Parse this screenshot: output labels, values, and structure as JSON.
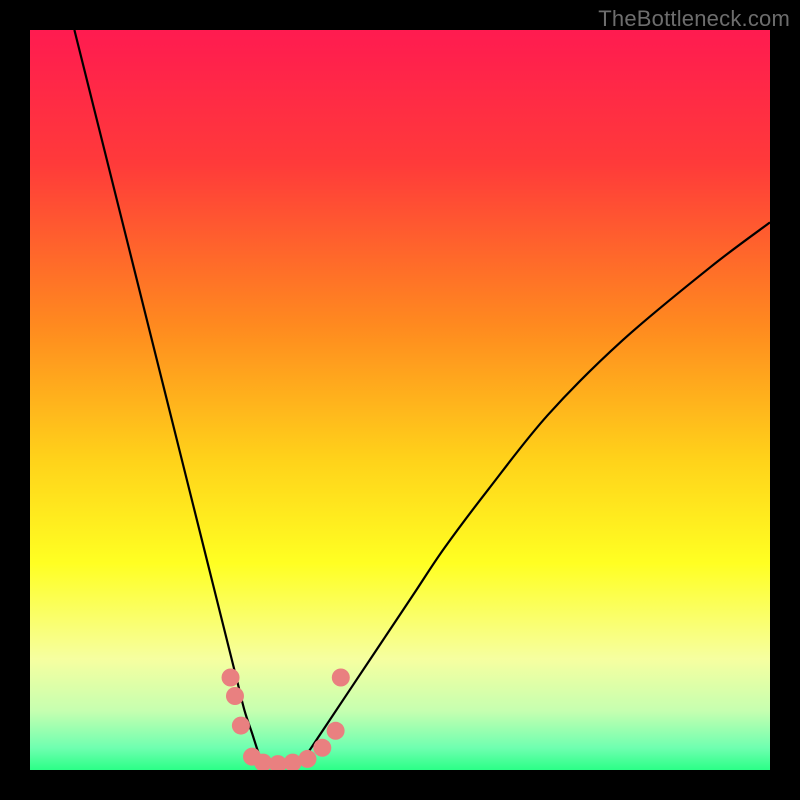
{
  "watermark": "TheBottleneck.com",
  "chart_data": {
    "type": "line",
    "title": "",
    "xlabel": "",
    "ylabel": "",
    "xlim": [
      0,
      100
    ],
    "ylim": [
      0,
      100
    ],
    "gradient_stops": [
      {
        "offset": 0.0,
        "color": "#ff1b50"
      },
      {
        "offset": 0.18,
        "color": "#ff3a3a"
      },
      {
        "offset": 0.4,
        "color": "#ff8a1f"
      },
      {
        "offset": 0.58,
        "color": "#ffd21a"
      },
      {
        "offset": 0.72,
        "color": "#ffff22"
      },
      {
        "offset": 0.85,
        "color": "#f6ffa0"
      },
      {
        "offset": 0.92,
        "color": "#c6ffb0"
      },
      {
        "offset": 0.97,
        "color": "#6fffb0"
      },
      {
        "offset": 1.0,
        "color": "#2bff87"
      }
    ],
    "series": [
      {
        "name": "left-branch",
        "x": [
          6,
          8,
          10,
          12,
          14,
          16,
          18,
          20,
          22,
          24,
          26,
          27,
          28,
          29,
          30,
          31,
          32
        ],
        "y": [
          100,
          92,
          84,
          76,
          68,
          60,
          52,
          44,
          36,
          28,
          20,
          16,
          12,
          8,
          5,
          2,
          0
        ]
      },
      {
        "name": "right-branch",
        "x": [
          36,
          38,
          40,
          44,
          48,
          52,
          56,
          62,
          70,
          80,
          92,
          100
        ],
        "y": [
          0,
          3,
          6,
          12,
          18,
          24,
          30,
          38,
          48,
          58,
          68,
          74
        ]
      }
    ],
    "valley_markers": {
      "color": "#e98080",
      "radius_px": 9,
      "points": [
        {
          "x": 27.1,
          "y": 12.5
        },
        {
          "x": 27.7,
          "y": 10.0
        },
        {
          "x": 28.5,
          "y": 6.0
        },
        {
          "x": 30.0,
          "y": 1.8
        },
        {
          "x": 31.5,
          "y": 1.0
        },
        {
          "x": 33.5,
          "y": 0.8
        },
        {
          "x": 35.5,
          "y": 1.0
        },
        {
          "x": 37.5,
          "y": 1.5
        },
        {
          "x": 39.5,
          "y": 3.0
        },
        {
          "x": 41.3,
          "y": 5.3
        },
        {
          "x": 42.0,
          "y": 12.5
        }
      ]
    }
  }
}
